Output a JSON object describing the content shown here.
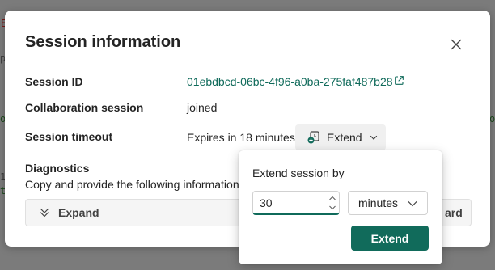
{
  "background": {
    "fragments": [
      "E",
      "py",
      "o",
      "1",
      "t",
      "o"
    ]
  },
  "dialog": {
    "title": "Session information",
    "close_icon": "close-icon",
    "rows": {
      "session_id": {
        "label": "Session ID",
        "value": "01ebdbcd-06bc-4f96-a0ba-275faf487b28"
      },
      "collaboration": {
        "label": "Collaboration session",
        "value": "joined"
      },
      "timeout": {
        "label": "Session timeout",
        "value": "Expires in 18 minutes.",
        "extend_label": "Extend"
      }
    },
    "diagnostics": {
      "label": "Diagnostics",
      "description": "Copy and provide the following information",
      "expand_label": "Expand",
      "right_fragment": "ard"
    }
  },
  "popover": {
    "title": "Extend session by",
    "amount": "30",
    "unit": "minutes",
    "button_label": "Extend"
  },
  "colors": {
    "accent": "#116b5b",
    "link": "#0f6a5a",
    "overlay": "#7b7b7b"
  }
}
